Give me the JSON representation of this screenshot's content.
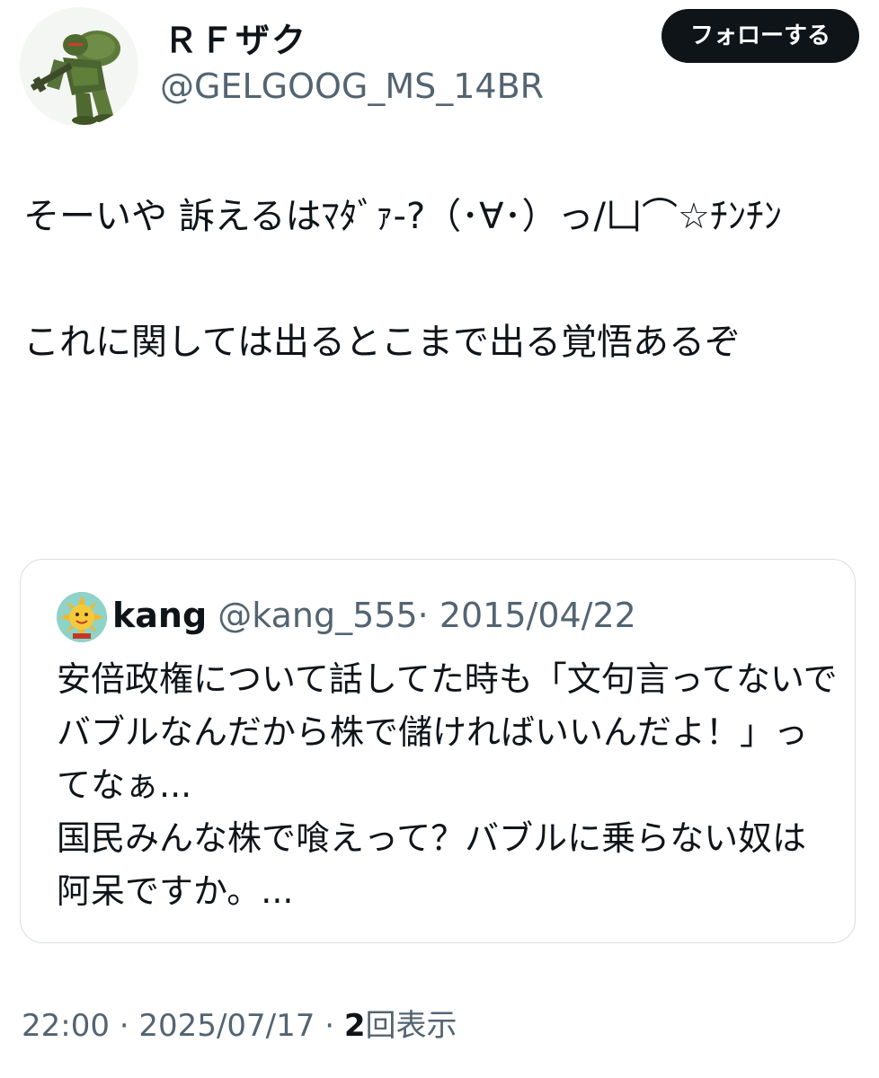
{
  "author": {
    "display_name": "ＲＦザク",
    "handle": "@GELGOOG_MS_14BR",
    "avatar_icon": "zaku-robot-avatar-icon"
  },
  "follow_button": {
    "label": "フォローする"
  },
  "tweet": {
    "text": "そーいや 訴えるはﾏﾀﾞｧ-?（･∀･）っ/凵⌒☆ﾁﾝﾁﾝ\n\nこれに関しては出るとこまで出る覚悟あるぞ"
  },
  "quote": {
    "avatar_icon": "sun-face-avatar-icon",
    "name": "kang",
    "handle": "@kang_555",
    "separator": "·",
    "date": "2015/04/22",
    "text": "安倍政権について話してた時も「文句言ってないでバブルなんだから株で儲ければいいんだよ！」ってなぁ...\n国民みんな株で喰えって？バブルに乗らない奴は阿呆ですか。..."
  },
  "meta": {
    "time": "22:00",
    "separator": "·",
    "date": "2025/07/17",
    "views_count": "2",
    "views_label": "回表示"
  },
  "colors": {
    "text_primary": "#0f1419",
    "text_secondary": "#536471",
    "border": "#d9dee2",
    "button_bg": "#0f1419",
    "button_text": "#ffffff"
  }
}
